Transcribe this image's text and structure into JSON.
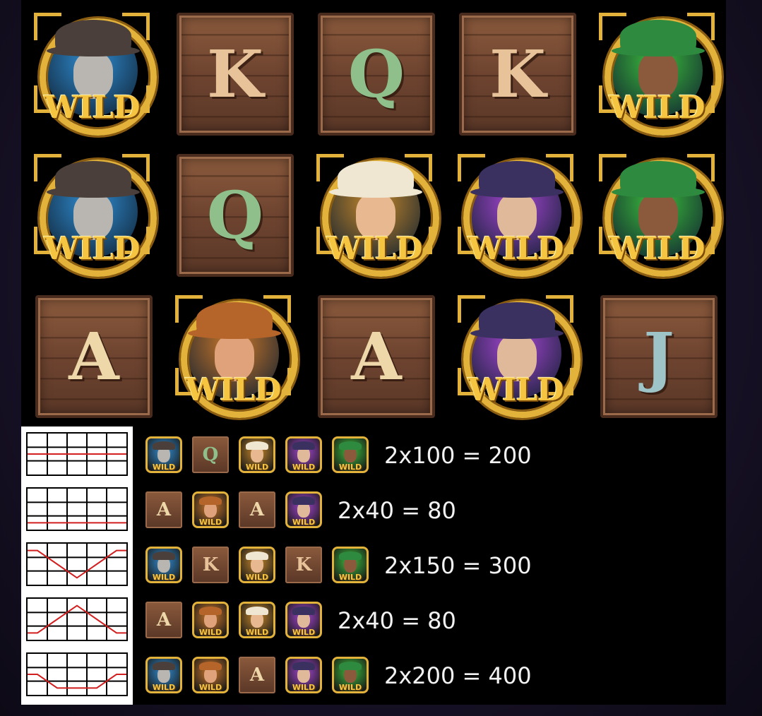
{
  "reels": [
    [
      "wild-masked",
      "K",
      "Q",
      "K",
      "wild-green"
    ],
    [
      "wild-masked",
      "Q",
      "wild-redhead",
      "wild-purple",
      "wild-green"
    ],
    [
      "A",
      "wild-orange",
      "A",
      "wild-purple",
      "J"
    ]
  ],
  "wild_label": "WILD",
  "symbols": {
    "K": {
      "label": "K",
      "color": "#e8c39a"
    },
    "Q": {
      "label": "Q",
      "color": "#8fbf8a"
    },
    "A": {
      "label": "A",
      "color": "#eed7a8"
    },
    "J": {
      "label": "J",
      "color": "#9fc4c8"
    },
    "wild-masked": {
      "bg": "#2f8fd6",
      "hat": "#4a3f3a",
      "face": "#b9b5b0"
    },
    "wild-green": {
      "bg": "#3cc03c",
      "hat": "#2e8a3e",
      "face": "#8b5a3c"
    },
    "wild-redhead": {
      "bg": "#c98a2a",
      "hat": "#efe7d2",
      "face": "#e8b890"
    },
    "wild-purple": {
      "bg": "#a846d6",
      "hat": "#3a3160",
      "face": "#e0b89a"
    },
    "wild-orange": {
      "bg": "#d07a2a",
      "hat": "#b5652a",
      "face": "#e0a27a"
    }
  },
  "paylines": [
    {
      "symbols": [
        "wild-masked",
        "Q",
        "wild-redhead",
        "wild-purple",
        "wild-green"
      ],
      "payout": "2x100 = 200"
    },
    {
      "symbols": [
        "A",
        "wild-orange",
        "A",
        "wild-purple"
      ],
      "payout": "2x40 = 80"
    },
    {
      "symbols": [
        "wild-masked",
        "K",
        "wild-redhead",
        "K",
        "wild-green"
      ],
      "payout": "2x150 = 300"
    },
    {
      "symbols": [
        "A",
        "wild-orange",
        "wild-redhead",
        "wild-purple"
      ],
      "payout": "2x40 = 80"
    },
    {
      "symbols": [
        "wild-masked",
        "wild-orange",
        "A",
        "wild-purple",
        "wild-green"
      ],
      "payout": "2x200 = 400"
    }
  ],
  "payline_pattern_rows": [
    [
      1,
      1,
      1,
      1,
      1
    ],
    [
      2,
      2,
      2,
      2,
      2
    ],
    [
      0,
      1,
      2,
      1,
      0
    ],
    [
      2,
      1,
      0,
      1,
      2
    ],
    [
      1,
      2,
      2,
      2,
      1
    ]
  ],
  "payline_color": "#d21f1f"
}
